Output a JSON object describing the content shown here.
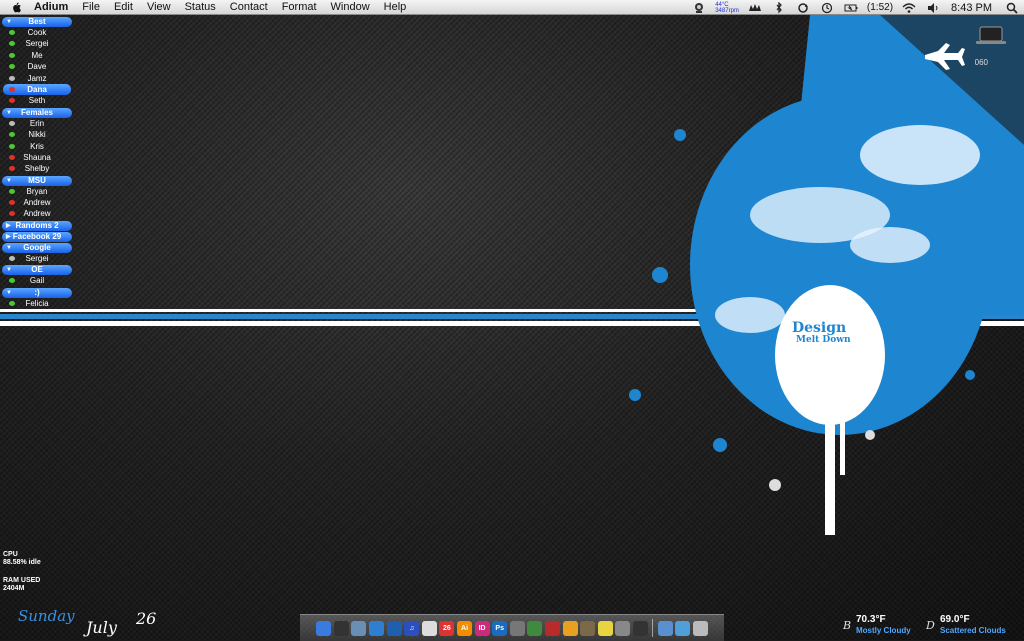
{
  "menubar": {
    "app": "Adium",
    "items": [
      "File",
      "Edit",
      "View",
      "Status",
      "Contact",
      "Format",
      "Window",
      "Help"
    ],
    "temp_line1": "44°C",
    "temp_line2": "3487rpm",
    "battery": "(1:52)",
    "clock": "8:43 PM"
  },
  "contacts": {
    "groups": [
      {
        "name": "Best",
        "contacts": [
          {
            "name": "Cook",
            "status": "green"
          },
          {
            "name": "Sergei",
            "status": "green"
          },
          {
            "name": "Me",
            "status": "green"
          },
          {
            "name": "Dave",
            "status": "green"
          },
          {
            "name": "Jamz",
            "status": "grey"
          },
          {
            "name": "Dana",
            "status": "red",
            "selected": true
          },
          {
            "name": "Seth",
            "status": "red"
          }
        ]
      },
      {
        "name": "Females",
        "contacts": [
          {
            "name": "Erin",
            "status": "grey"
          },
          {
            "name": "Nikki",
            "status": "green"
          },
          {
            "name": "Kris",
            "status": "green"
          },
          {
            "name": "Shauna",
            "status": "red"
          },
          {
            "name": "Shelby",
            "status": "red"
          }
        ]
      },
      {
        "name": "MSU",
        "contacts": [
          {
            "name": "Bryan",
            "status": "green"
          },
          {
            "name": "Andrew",
            "status": "red"
          },
          {
            "name": "Andrew",
            "status": "red"
          }
        ]
      },
      {
        "name": "Randoms  2",
        "collapsed": true,
        "contacts": []
      },
      {
        "name": "Facebook  29",
        "collapsed": true,
        "contacts": []
      },
      {
        "name": "Google",
        "contacts": [
          {
            "name": "Sergei",
            "status": "grey"
          }
        ]
      },
      {
        "name": "OE",
        "contacts": [
          {
            "name": "Gail",
            "status": "green"
          }
        ]
      },
      {
        "name": ":)",
        "contacts": [
          {
            "name": "Felicia",
            "status": "green"
          }
        ]
      }
    ]
  },
  "desktop": {
    "logo_line1": "Design",
    "logo_line2": "Melt Down",
    "drive_label": "060"
  },
  "stats": {
    "cpu_label": "CPU",
    "cpu_value": "88.58% idle",
    "ram_label": "RAM USED",
    "ram_value": "2404M"
  },
  "date": {
    "weekday": "Sunday",
    "month": "July",
    "day": "26"
  },
  "weather": [
    {
      "temp": "70.3°F",
      "desc": "Mostly Cloudy"
    },
    {
      "temp": "69.0°F",
      "desc": "Scattered Clouds"
    }
  ],
  "dock": [
    {
      "name": "finder",
      "color": "#3a7be0",
      "glyph": ""
    },
    {
      "name": "dashboard",
      "color": "#333",
      "glyph": ""
    },
    {
      "name": "preview",
      "color": "#6a8fb5",
      "glyph": ""
    },
    {
      "name": "safari",
      "color": "#2e7fd1",
      "glyph": ""
    },
    {
      "name": "browser",
      "color": "#1f5fb0",
      "glyph": ""
    },
    {
      "name": "itunes",
      "color": "#2a4fbf",
      "glyph": "♫"
    },
    {
      "name": "adium",
      "color": "#dddddd",
      "glyph": ""
    },
    {
      "name": "ical",
      "color": "#d33",
      "glyph": "26"
    },
    {
      "name": "illustrator",
      "color": "#f28d00",
      "glyph": "Ai"
    },
    {
      "name": "indesign",
      "color": "#cc2a7a",
      "glyph": "ID"
    },
    {
      "name": "photoshop",
      "color": "#1b6bbf",
      "glyph": "Ps"
    },
    {
      "name": "pen-tool",
      "color": "#777",
      "glyph": ""
    },
    {
      "name": "dreamweaver",
      "color": "#3f8a3f",
      "glyph": ""
    },
    {
      "name": "photo-booth",
      "color": "#b92a2a",
      "glyph": ""
    },
    {
      "name": "textedit",
      "color": "#e8a020",
      "glyph": ""
    },
    {
      "name": "iphoto",
      "color": "#7a6a4a",
      "glyph": ""
    },
    {
      "name": "stickies",
      "color": "#e8d340",
      "glyph": ""
    },
    {
      "name": "system-preferences",
      "color": "#888",
      "glyph": ""
    },
    {
      "name": "dvd-player",
      "color": "#333",
      "glyph": ""
    },
    {
      "name": "applications-folder",
      "color": "#5a8fd0",
      "glyph": ""
    },
    {
      "name": "downloads-folder",
      "color": "#4f9fd8",
      "glyph": ""
    },
    {
      "name": "trash",
      "color": "#bbb",
      "glyph": ""
    }
  ]
}
